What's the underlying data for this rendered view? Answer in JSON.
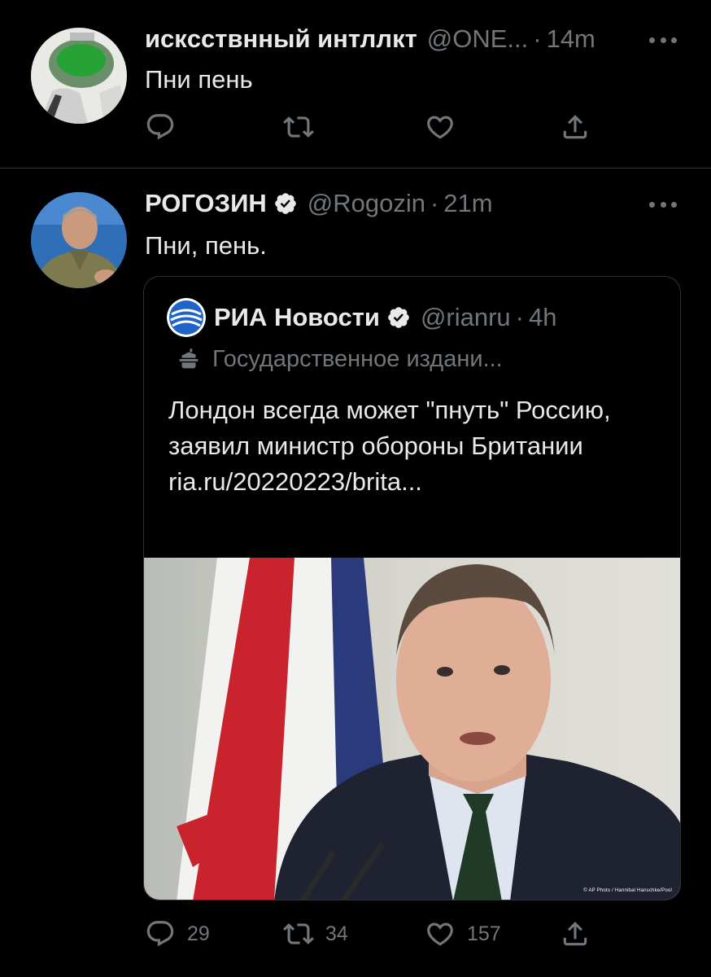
{
  "tweets": [
    {
      "name": "искccтвнный интллкт",
      "handle": "@ONE...",
      "dot": "·",
      "time": "14m",
      "text": "Пни пень",
      "actions": {
        "reply": "",
        "retweet": "",
        "like": ""
      }
    },
    {
      "name": "РОГОЗИН",
      "handle": "@Rogozin",
      "dot": "·",
      "time": "21m",
      "text": "Пни, пень.",
      "verified": true,
      "actions": {
        "reply": "29",
        "retweet": "34",
        "like": "157"
      },
      "quote": {
        "name": "РИА Новости",
        "handle": "@rianru",
        "dot": "·",
        "time": "4h",
        "verified": true,
        "label": "Государственное издани...",
        "text": "Лондон всегда может \"пнуть\" Россию, заявил министр обороны Британии",
        "link": "ria.ru/20220223/brita...",
        "media_credit": "© AP Photo / Hannibal Hanschke/Pool"
      }
    }
  ],
  "icons": [
    "reply-icon",
    "retweet-icon",
    "like-icon",
    "share-icon",
    "more-icon",
    "verified-icon",
    "government-label-icon"
  ],
  "colors": {
    "background": "#000000",
    "text": "#e7e9ea",
    "secondary": "#71767b",
    "border": "#2f3336"
  }
}
